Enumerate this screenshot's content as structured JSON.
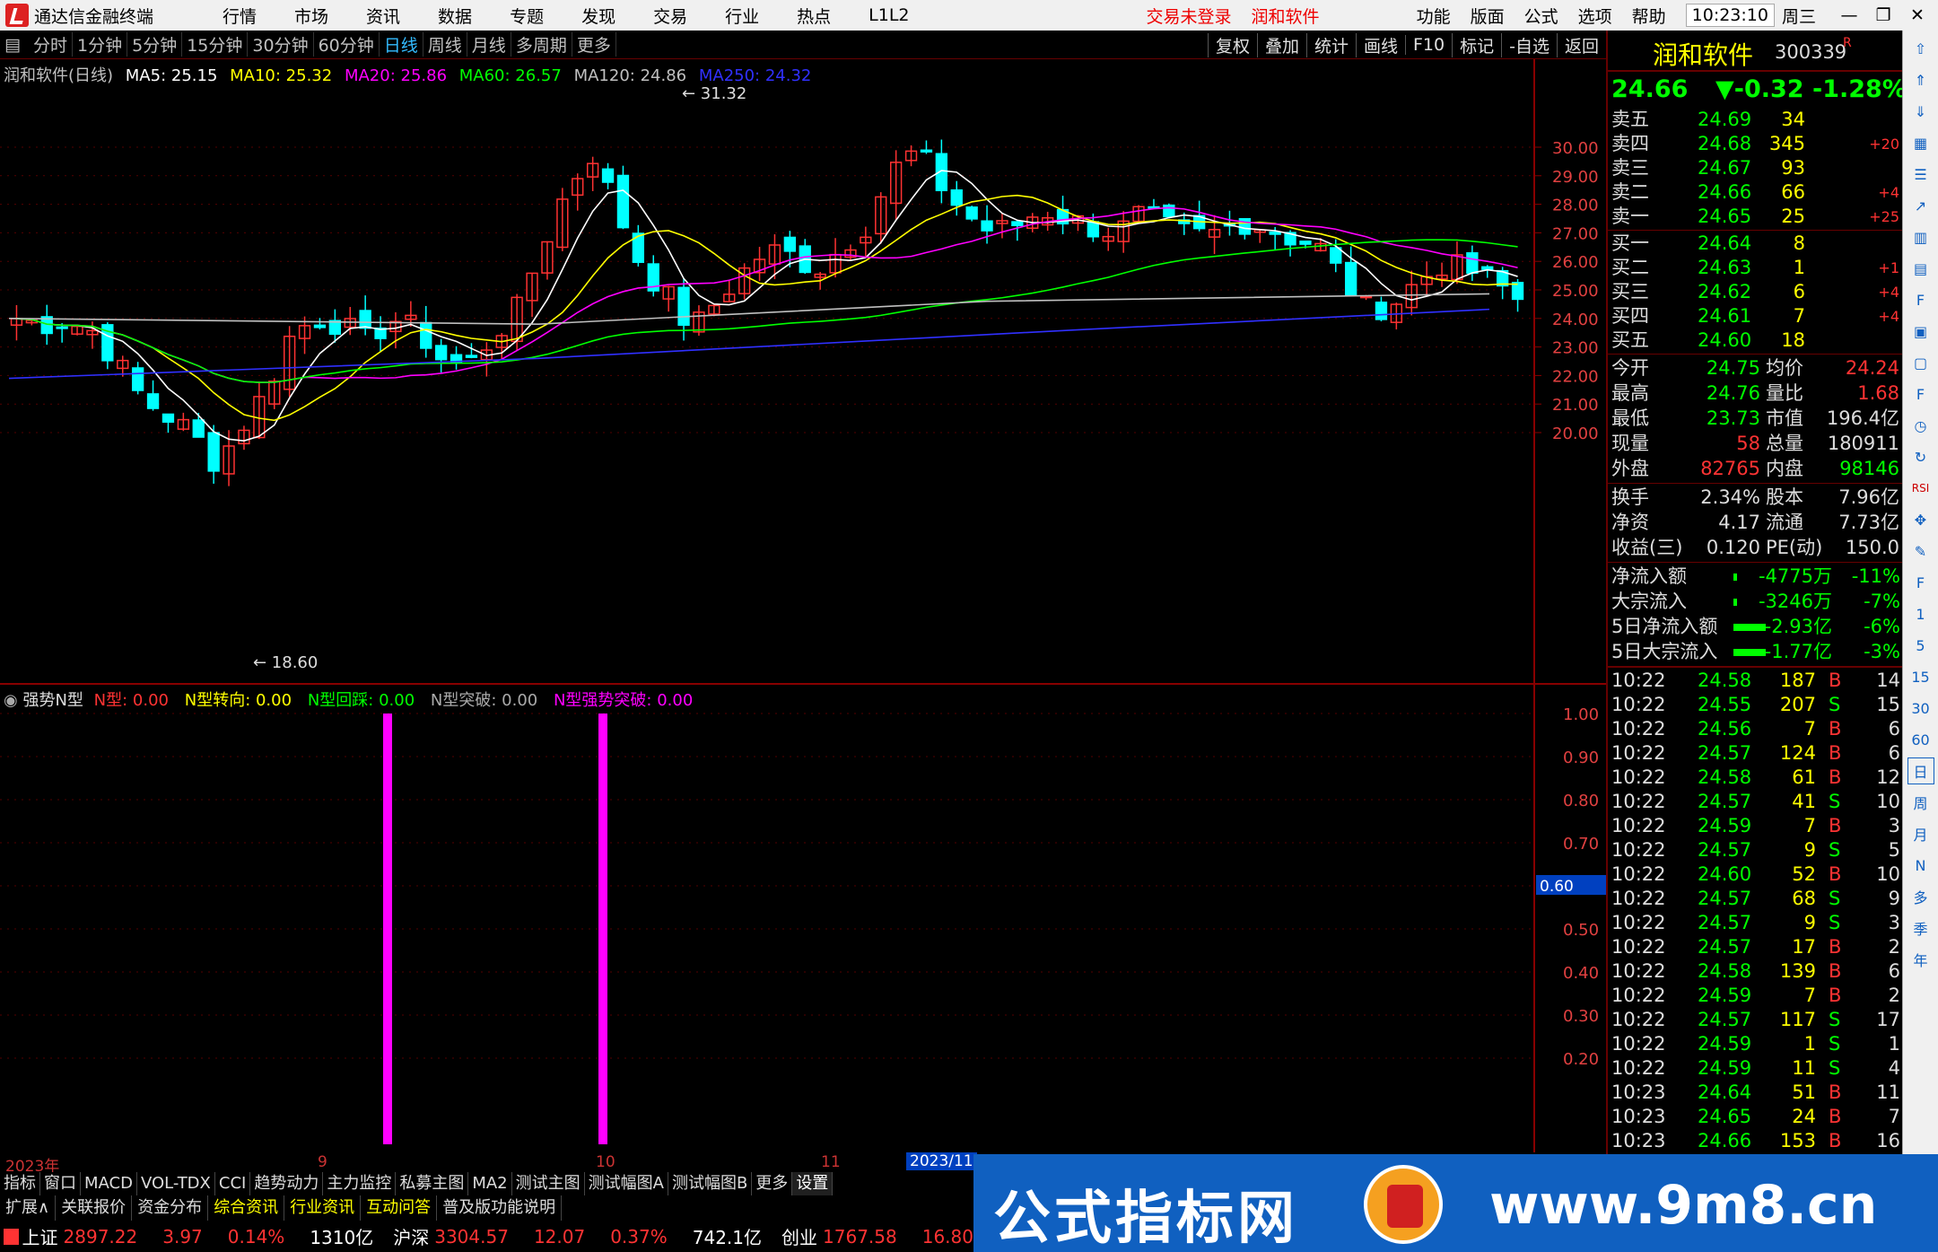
{
  "app": {
    "title": "通达信金融终端"
  },
  "menu": {
    "items": [
      "行情",
      "市场",
      "资讯",
      "数据",
      "专题",
      "发现",
      "交易",
      "行业",
      "热点",
      "L1L2"
    ],
    "trade_status": "交易未登录",
    "stock_link": "润和软件",
    "right_items": [
      "功能",
      "版面",
      "公式",
      "选项",
      "帮助"
    ],
    "clock": "10:23:10",
    "weekday": "周三"
  },
  "period_tabs": [
    "分时",
    "1分钟",
    "5分钟",
    "15分钟",
    "30分钟",
    "60分钟",
    "日线",
    "周线",
    "月线",
    "多周期",
    "更多"
  ],
  "period_selected": "日线",
  "toolbar_right": [
    "复权",
    "叠加",
    "统计",
    "画线",
    "F10",
    "标记",
    "-自选",
    "返回"
  ],
  "ma_legend": {
    "name": "润和软件(日线)",
    "ma5": "MA5: 25.15",
    "ma10": "MA10: 25.32",
    "ma20": "MA20: 25.86",
    "ma60": "MA60: 26.57",
    "ma120": "MA120: 24.86",
    "ma250": "MA250: 24.32"
  },
  "price_axis": [
    "30.00",
    "29.00",
    "28.00",
    "27.00",
    "26.00",
    "25.00",
    "24.00",
    "23.00",
    "22.00",
    "21.00",
    "20.00"
  ],
  "price_high_label": "31.32",
  "price_low_label": "18.60",
  "indicator_legend": {
    "name": "强势N型",
    "n": "N型: 0.00",
    "turn": "N型转向: 0.00",
    "pullback": "N型回踩: 0.00",
    "break": "N型突破: 0.00",
    "strong": "N型强势突破: 0.00"
  },
  "indicator_axis": [
    "1.00",
    "0.90",
    "0.80",
    "0.70",
    "0.60",
    "0.50",
    "0.40",
    "0.30",
    "0.20"
  ],
  "indicator_cursor": "0.60",
  "date_labels": [
    "2023年",
    "9",
    "10",
    "11",
    "2023/11"
  ],
  "bottom_tabs": [
    "指标",
    "窗口",
    "MACD",
    "VOL-TDX",
    "CCI",
    "趋势动力",
    "主力监控",
    "私募主图",
    "MA2",
    "测试主图",
    "测试幅图A",
    "测试幅图B",
    "更多",
    "设置"
  ],
  "bottom_tabs2": [
    "扩展∧",
    "关联报价",
    "资金分布",
    "综合资讯",
    "行业资讯",
    "互动问答",
    "普及版功能说明"
  ],
  "status": [
    {
      "name": "上证",
      "value": "2897.22",
      "chg": "3.97",
      "pct": "0.14%",
      "amt": "1310亿"
    },
    {
      "name": "沪深",
      "value": "3304.57",
      "chg": "12.07",
      "pct": "0.37%",
      "amt": "742.1亿"
    },
    {
      "name": "创业",
      "value": "1767.58",
      "chg": "16.80",
      "pct": "",
      "amt": ""
    }
  ],
  "quote": {
    "name": "润和软件",
    "code": "300339",
    "price": "24.66",
    "change": "▼-0.32",
    "pct": "-1.28%",
    "sells": [
      {
        "label": "卖五",
        "price": "24.69",
        "vol": "34",
        "chg": ""
      },
      {
        "label": "卖四",
        "price": "24.68",
        "vol": "345",
        "chg": "+20"
      },
      {
        "label": "卖三",
        "price": "24.67",
        "vol": "93",
        "chg": ""
      },
      {
        "label": "卖二",
        "price": "24.66",
        "vol": "66",
        "chg": "+4"
      },
      {
        "label": "卖一",
        "price": "24.65",
        "vol": "25",
        "chg": "+25"
      }
    ],
    "buys": [
      {
        "label": "买一",
        "price": "24.64",
        "vol": "8",
        "chg": ""
      },
      {
        "label": "买二",
        "price": "24.63",
        "vol": "1",
        "chg": "+1"
      },
      {
        "label": "买三",
        "price": "24.62",
        "vol": "6",
        "chg": "+4"
      },
      {
        "label": "买四",
        "price": "24.61",
        "vol": "7",
        "chg": "+4"
      },
      {
        "label": "买五",
        "price": "24.60",
        "vol": "18",
        "chg": ""
      }
    ],
    "stats": [
      {
        "l1": "今开",
        "v1": "24.75",
        "l2": "均价",
        "v2": "24.24"
      },
      {
        "l1": "最高",
        "v1": "24.76",
        "l2": "量比",
        "v2": "1.68"
      },
      {
        "l1": "最低",
        "v1": "23.73",
        "l2": "市值",
        "v2": "196.4亿"
      },
      {
        "l1": "现量",
        "v1": "58",
        "l2": "总量",
        "v2": "180911"
      },
      {
        "l1": "外盘",
        "v1": "82765",
        "l2": "内盘",
        "v2": "98146"
      }
    ],
    "stats2": [
      {
        "l1": "换手",
        "v1": "2.34%",
        "l2": "股本",
        "v2": "7.96亿"
      },
      {
        "l1": "净资",
        "v1": "4.17",
        "l2": "流通",
        "v2": "7.73亿"
      },
      {
        "l1": "收益(三)",
        "v1": "0.120",
        "l2": "PE(动)",
        "v2": "150.0"
      }
    ],
    "flows": [
      {
        "label": "净流入额",
        "value": "-4775万",
        "pct": "-11%"
      },
      {
        "label": "大宗流入",
        "value": "-3246万",
        "pct": "-7%"
      },
      {
        "label": "5日净流入额",
        "value": "-2.93亿",
        "pct": "-6%"
      },
      {
        "label": "5日大宗流入",
        "value": "-1.77亿",
        "pct": "-3%"
      }
    ],
    "ticks": [
      [
        "10:22",
        "24.58",
        "187",
        "B",
        "14"
      ],
      [
        "10:22",
        "24.55",
        "207",
        "S",
        "15"
      ],
      [
        "10:22",
        "24.56",
        "7",
        "B",
        "6"
      ],
      [
        "10:22",
        "24.57",
        "124",
        "B",
        "6"
      ],
      [
        "10:22",
        "24.58",
        "61",
        "B",
        "12"
      ],
      [
        "10:22",
        "24.57",
        "41",
        "S",
        "10"
      ],
      [
        "10:22",
        "24.59",
        "7",
        "B",
        "3"
      ],
      [
        "10:22",
        "24.57",
        "9",
        "S",
        "5"
      ],
      [
        "10:22",
        "24.60",
        "52",
        "B",
        "10"
      ],
      [
        "10:22",
        "24.57",
        "68",
        "S",
        "9"
      ],
      [
        "10:22",
        "24.57",
        "9",
        "S",
        "3"
      ],
      [
        "10:22",
        "24.57",
        "17",
        "B",
        "2"
      ],
      [
        "10:22",
        "24.58",
        "139",
        "B",
        "6"
      ],
      [
        "10:22",
        "24.59",
        "7",
        "B",
        "2"
      ],
      [
        "10:22",
        "24.57",
        "117",
        "S",
        "17"
      ],
      [
        "10:22",
        "24.59",
        "1",
        "S",
        "1"
      ],
      [
        "10:22",
        "24.59",
        "11",
        "S",
        "4"
      ],
      [
        "10:23",
        "24.64",
        "51",
        "B",
        "11"
      ],
      [
        "10:23",
        "24.65",
        "24",
        "B",
        "7"
      ],
      [
        "10:23",
        "24.66",
        "153",
        "B",
        "16"
      ]
    ]
  },
  "right_toolbar": [
    "日",
    "周",
    "月",
    "N",
    "多",
    "季",
    "年"
  ],
  "watermark": {
    "text1": "公式指标网",
    "text2": "www.9m8.cn"
  },
  "colors": {
    "up": "#ff3232",
    "down": "#00ffff",
    "ma5": "#ffffff",
    "ma10": "#ffff00",
    "ma20": "#ff00ff",
    "ma60": "#00ff00",
    "ma120": "#c0c0c0",
    "ma250": "#3030ff",
    "bar": "#ff00ff"
  }
}
